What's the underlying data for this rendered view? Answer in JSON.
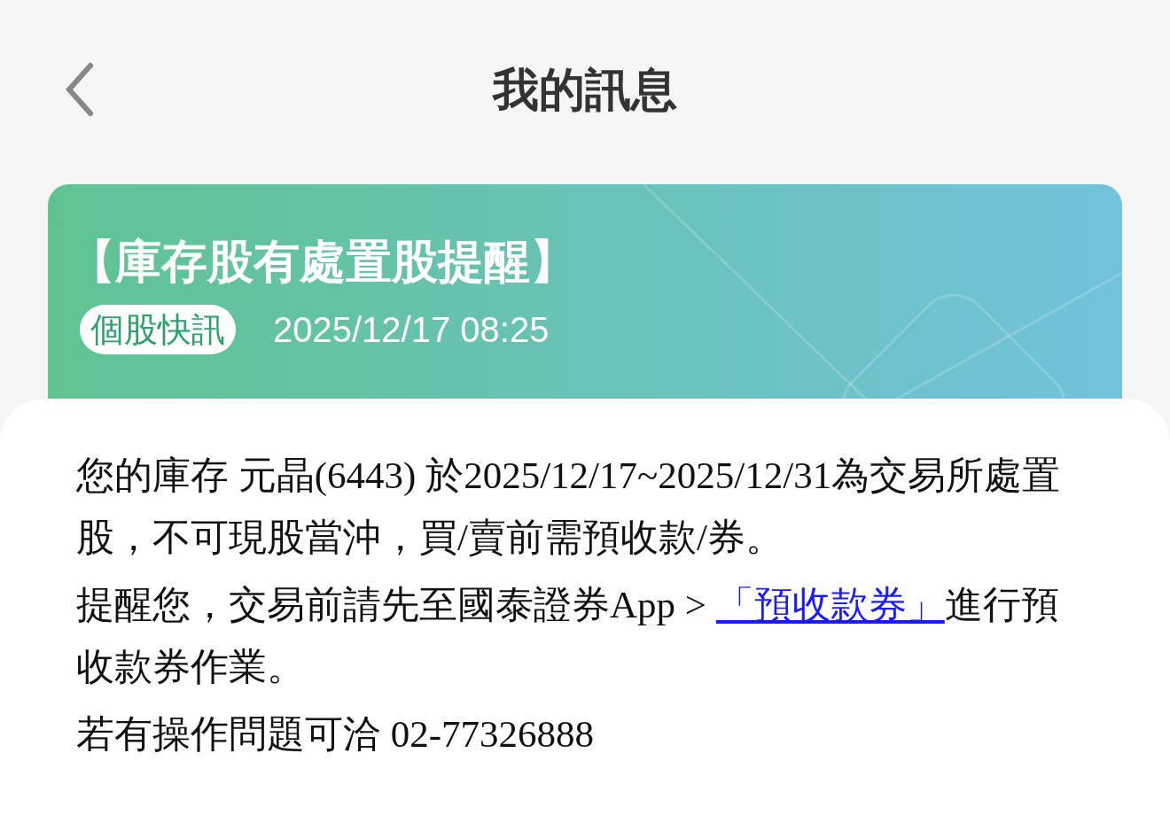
{
  "header": {
    "title": "我的訊息"
  },
  "card": {
    "title": "【庫存股有處置股提醒】",
    "tag": "個股快訊",
    "time": "2025/12/17 08:25"
  },
  "body": {
    "paragraphs": [
      {
        "kind": "text",
        "text": "您的庫存 元晶(6443) 於2025/12/17~2025/12/31為交易所處置股，不可現股當沖，買/賣前需預收款/券。"
      },
      {
        "kind": "link",
        "before": "提醒您，交易前請先至國泰證券App > ",
        "link": "「預收款券」",
        "after": "進行預收款券作業。"
      },
      {
        "kind": "text",
        "text": "若有操作問題可洽 02-77326888"
      }
    ]
  }
}
